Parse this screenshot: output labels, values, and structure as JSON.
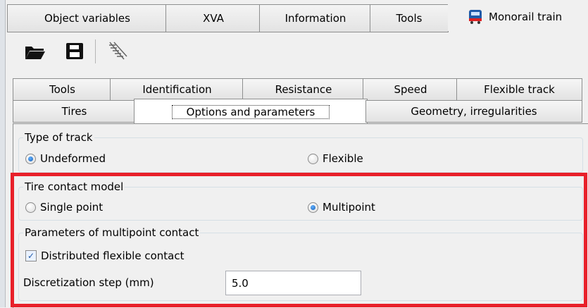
{
  "top_tabs": [
    {
      "label": "Object variables"
    },
    {
      "label": "XVA"
    },
    {
      "label": "Information"
    },
    {
      "label": "Tools"
    }
  ],
  "active_window": {
    "label": "Monorail train",
    "icon": "train-icon"
  },
  "toolbar": {
    "icons": [
      "open-folder-icon",
      "save-icon",
      "track-icon"
    ]
  },
  "inner_tabs_row1": [
    {
      "label": "Tools"
    },
    {
      "label": "Identification"
    },
    {
      "label": "Resistance"
    },
    {
      "label": "Speed"
    },
    {
      "label": "Flexible track"
    }
  ],
  "inner_tabs_row2": [
    {
      "label": "Tires"
    },
    {
      "label": "Options and parameters"
    },
    {
      "label": "Geometry, irregularities"
    }
  ],
  "type_of_track": {
    "title": "Type of track",
    "options": [
      {
        "label": "Undeformed",
        "checked": true
      },
      {
        "label": "Flexible",
        "checked": false
      }
    ]
  },
  "tire_contact_model": {
    "title": "Tire contact model",
    "options": [
      {
        "label": "Single point",
        "checked": false
      },
      {
        "label": "Multipoint",
        "checked": true
      }
    ]
  },
  "multipoint_params": {
    "title": "Parameters of multipoint contact",
    "distributed_label": "Distributed flexible contact",
    "distributed_checked": true,
    "step_label": "Discretization step (mm)",
    "step_value": "5.0"
  },
  "colors": {
    "highlight_box": "#e8202a",
    "radio_checked": "#1a5fb4"
  }
}
